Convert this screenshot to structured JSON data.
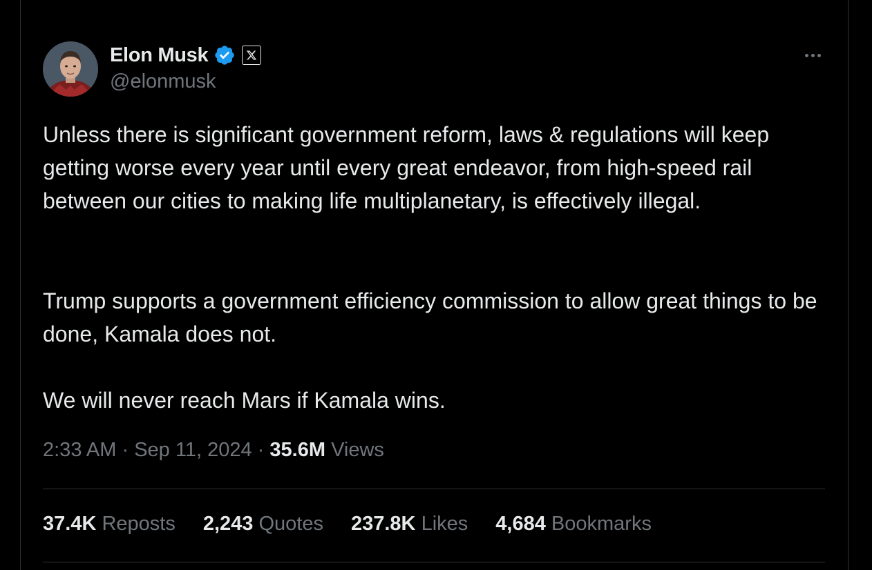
{
  "author": {
    "display_name": "Elon Musk",
    "handle": "@elonmusk",
    "verified_icon": "verified-badge-icon",
    "affiliation_icon": "x-logo-icon"
  },
  "tweet": {
    "paragraphs": [
      "Unless there is significant government reform, laws & regulations will keep getting worse every year until every great endeavor, from high-speed rail between our cities to making life multiplanetary, is effectively illegal.",
      "Trump supports a government efficiency commission to allow great things to be done, Kamala does not.",
      "We will never reach Mars if Kamala wins."
    ]
  },
  "meta": {
    "time": "2:33 AM",
    "separator": "·",
    "date": "Sep 11, 2024",
    "views_count": "35.6M",
    "views_label": "Views"
  },
  "stats": [
    {
      "count": "37.4K",
      "label": "Reposts"
    },
    {
      "count": "2,243",
      "label": "Quotes"
    },
    {
      "count": "237.8K",
      "label": "Likes"
    },
    {
      "count": "4,684",
      "label": "Bookmarks"
    }
  ],
  "colors": {
    "background": "#000000",
    "text": "#e7e9ea",
    "muted": "#71767b",
    "verified": "#1d9bf0",
    "border": "#2f3336"
  }
}
